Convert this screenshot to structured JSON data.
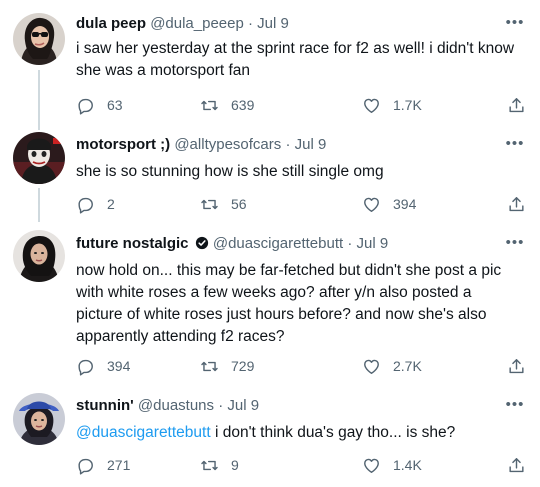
{
  "tweets": [
    {
      "name": "dula peep",
      "handle": "@dula_peeep",
      "date": "Jul 9",
      "text": "i saw her yesterday at the sprint race for f2 as well! i didn't know she was a motorsport fan",
      "replies": "63",
      "retweets": "639",
      "likes": "1.7K"
    },
    {
      "name": "motorsport ;)",
      "handle": "@alltypesofcars",
      "date": "Jul 9",
      "text": "she is so stunning how is she still single omg",
      "replies": "2",
      "retweets": "56",
      "likes": "394"
    },
    {
      "name": "future nostalgic",
      "handle": "@duascigarettebutt",
      "date": "Jul 9",
      "text": "now hold on... this may be far-fetched but didn't she post a pic with white roses a few weeks ago? after y/n also posted a picture of white roses just hours before? and now she's also apparently attending f2 races?",
      "replies": "394",
      "retweets": "729",
      "likes": "2.7K"
    },
    {
      "name": "stunnin'",
      "handle": "@duastuns",
      "date": "Jul 9",
      "mention": "@duascigarettebutt",
      "text": " i don't think dua's gay tho... is she?",
      "replies": "271",
      "retweets": "9",
      "likes": "1.4K"
    }
  ],
  "separator": "·",
  "more_label": "•••",
  "colors": {
    "text": "#0f1419",
    "secondary": "#536471",
    "link": "#1d9bf0",
    "thread_line": "#cfd9de"
  },
  "icons": [
    "reply-icon",
    "retweet-icon",
    "like-icon",
    "share-icon",
    "more-icon",
    "verified-icon"
  ]
}
